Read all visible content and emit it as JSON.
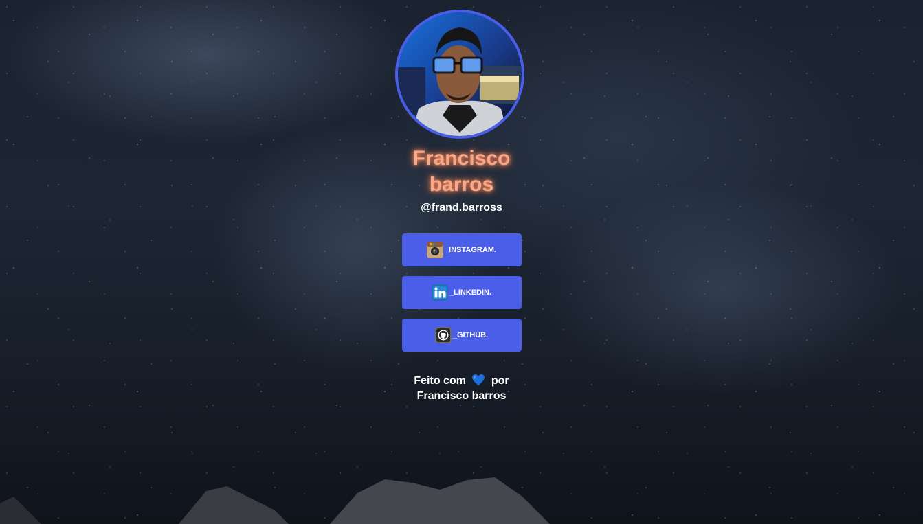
{
  "profile": {
    "name": "Francisco barros",
    "handle": "@frand.barross",
    "accent_color": "#4a5ee8",
    "name_color": "#f6a98a"
  },
  "links": [
    {
      "label": "_INSTAGRAM.",
      "icon": "instagram-icon"
    },
    {
      "label": "_LINKEDIN.",
      "icon": "linkedin-icon"
    },
    {
      "label": "_GITHUB.",
      "icon": "github-icon"
    }
  ],
  "footer": {
    "line1_before": "Feito com",
    "heart_icon": "blue-heart-icon",
    "line1_after": "por",
    "line2": "Francisco barros",
    "heart_color": "#1e6fd9"
  }
}
